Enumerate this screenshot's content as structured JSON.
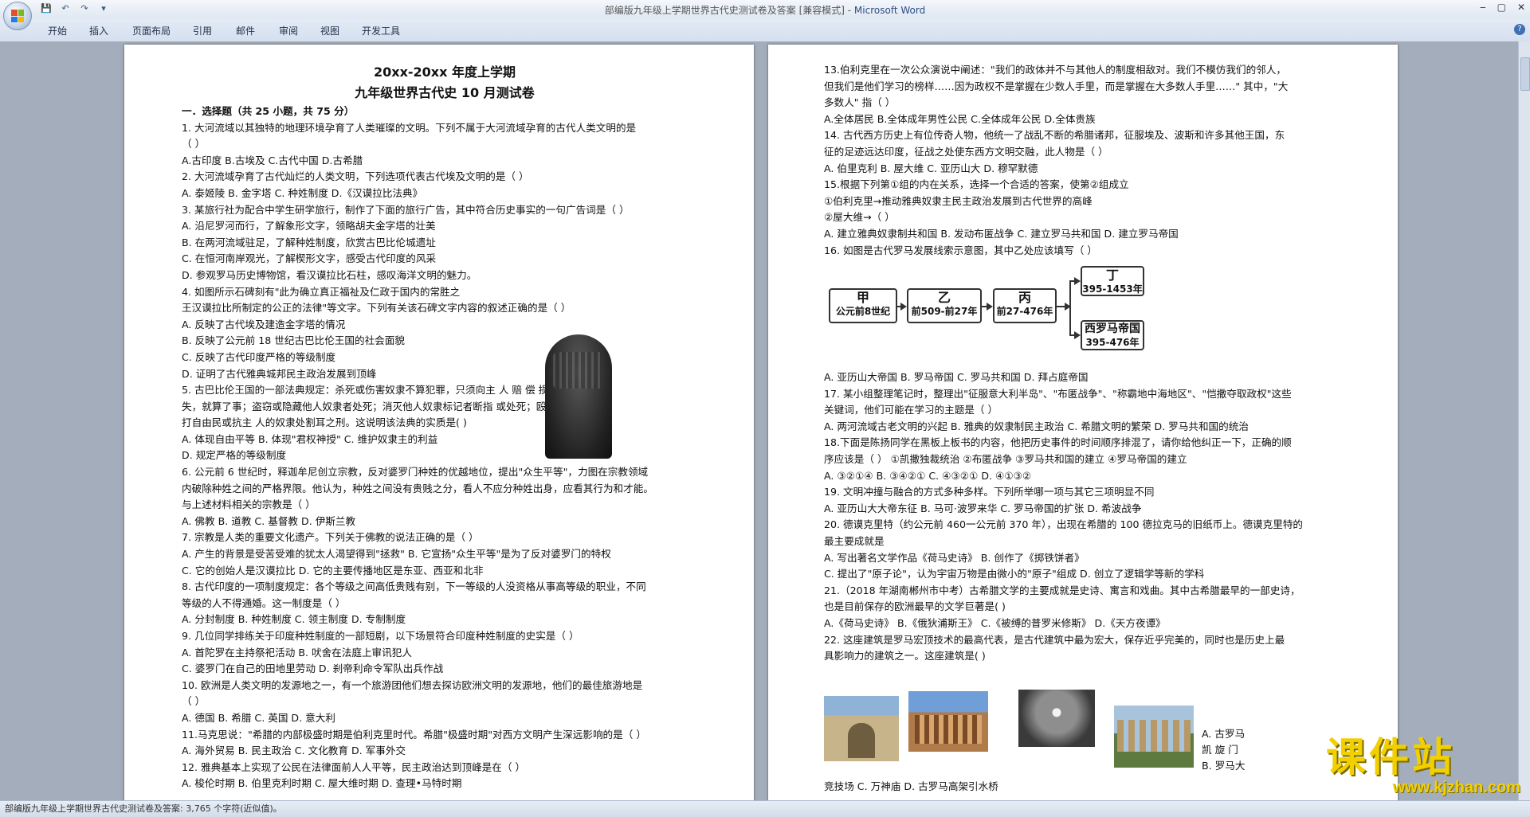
{
  "window": {
    "title": "部编版九年级上学期世界古代史测试卷及答案 [兼容模式] - ",
    "app_name": "Microsoft Word",
    "controls": [
      "‒",
      "▢",
      "✕"
    ]
  },
  "quick_access": {
    "save": "💾",
    "undo": "↶",
    "redo": "↷",
    "customize": "▾"
  },
  "ribbon": {
    "tabs": [
      "开始",
      "插入",
      "页面布局",
      "引用",
      "邮件",
      "审阅",
      "视图",
      "开发工具"
    ],
    "help": "?"
  },
  "page1": {
    "title1": "20xx-20xx 年度上学期",
    "title2": "九年级世界古代史 10 月测试卷",
    "lines": [
      "一．选择题（共 25 小题，共 75 分）",
      "1. 大河流域以其独特的地理环境孕育了人类璀璨的文明。下列不属于大河流域孕育的古代人类文明的是",
      "（     ）",
      "A.古印度      B.古埃及      C.古代中国      D.古希腊",
      "2. 大河流域孕育了古代灿烂的人类文明，下列选项代表古代埃及文明的是（     ）",
      "A. 泰姬陵      B. 金字塔      C. 种姓制度      D.《汉谟拉比法典》",
      "3. 某旅行社为配合中学生研学旅行，制作了下面的旅行广告，其中符合历史事实的一句广告词是（     ）",
      "A. 沿尼罗河而行，了解象形文字，领略胡夫金字塔的壮美",
      "B. 在两河流域驻足，了解种姓制度，欣赏古巴比伦城遗址",
      "C. 在恒河南岸观光，了解楔形文字，感受古代印度的风采",
      "D. 参观罗马历史博物馆，看汉谟拉比石柱，感叹海洋文明的魅力。",
      "4. 如图所示石碑刻有\"此为确立真正福祉及仁政于国内的常胜之",
      "王汉谟拉比所制定的公正的法律\"等文字。下列有关该石碑文字内容的叙述正确的是（     ）",
      "A. 反映了古代埃及建造金字塔的情况",
      "B. 反映了公元前 18 世纪古巴比伦王国的社会面貌",
      "C. 反映了古代印度严格的等级制度",
      "D. 证明了古代雅典城邦民主政治发展到顶峰",
      "5. 古巴比伦王国的一部法典规定：杀死或伤害奴隶不算犯罪，只须向主                           人 赔 偿 损",
      "失，就算了事；盗窃或隐藏他人奴隶者处死；消灭他人奴隶标记者断指                           或处死；殴",
      "打自由民或抗主 人的奴隶处割耳之刑。这说明该法典的实质是(     )",
      "A. 体现自由平等         B. 体现\"君权神授\"         C. 维护奴隶主的利益",
      "D. 规定严格的等级制度",
      "6. 公元前 6 世纪时，释迦牟尼创立宗教，反对婆罗门种姓的优越地位，提出\"众生平等\"，力图在宗教领域",
      "内破除种姓之间的严格界限。他认为，种姓之间没有贵贱之分，看人不应分种姓出身，应看其行为和才能。",
      "与上述材料相关的宗教是（     ）",
      "A. 佛教          B. 道教          C. 基督教          D. 伊斯兰教",
      "7. 宗教是人类的重要文化遗产。下列关于佛教的说法正确的是（     ）",
      "A.  产生的背景是受苦受难的犹太人渴望得到\"拯救\"      B.  它宣扬\"众生平等\"是为了反对婆罗门的特权",
      "C.  它的创始人是汉谟拉比                  D.  它的主要传播地区是东亚、西亚和北非",
      "8. 古代印度的一项制度规定：各个等级之间高低贵贱有别，下一等级的人没资格从事高等级的职业，不同",
      "等级的人不得通婚。这一制度是（     ）",
      "A. 分封制度      B. 种姓制度      C. 领主制度      D. 专制制度",
      "9. 几位同学排练关于印度种姓制度的一部短剧，以下场景符合印度种姓制度的史实是（     ）",
      "A.  首陀罗在主持祭祀活动               B.  吠舍在法庭上审讯犯人",
      "C.  婆罗门在自己的田地里劳动           D.  刹帝利命令军队出兵作战",
      "10. 欧洲是人类文明的发源地之一，有一个旅游团他们想去探访欧洲文明的发源地，他们的最佳旅游地是",
      "（     ）",
      "A. 德国          B. 希腊          C. 英国          D. 意大利",
      "11.马克思说：\"希腊的内部极盛时期是伯利克里时代。希腊\"极盛时期\"对西方文明产生深远影响的是（     ）",
      "A. 海外贸易      B. 民主政治      C. 文化教育      D. 军事外交",
      "12. 雅典基本上实现了公民在法律面前人人平等，民主政治达到顶峰是在（     ）",
      "A. 梭伦时期          B. 伯里克利时期          C. 屋大维时期          D. 查理•马特时期"
    ]
  },
  "page2": {
    "lines_top": [
      "13.伯利克里在一次公众演说中阐述：\"我们的政体并不与其他人的制度相敌对。我们不模仿我们的邻人，",
      "但我们是他们学习的榜样……因为政权不是掌握在少数人手里，而是掌握在大多数人手里……\" 其中，\"大",
      "多数人\" 指（     ）",
      "A.全体居民          B.全体成年男性公民          C.全体成年公民          D.全体贵族",
      "14. 古代西方历史上有位传奇人物，他统一了战乱不断的希腊诸邦，征服埃及、波斯和许多其他王国，东",
      "征的足迹远达印度，征战之处使东西方文明交融，此人物是（     ）",
      "A. 伯里克利      B. 屋大维      C. 亚历山大      D. 穆罕默德",
      "15.根据下列第①组的内在关系，选择一个合适的答案，使第②组成立",
      "①伯利克里→推动雅典奴隶主民主政治发展到古代世界的高峰",
      "②屋大维→（     ）",
      "A. 建立雅典奴隶制共和国      B. 发动布匿战争      C. 建立罗马共和国      D. 建立罗马帝国",
      "16. 如图是古代罗马发展线索示意图，其中乙处应该填写（     ）"
    ],
    "diagram": {
      "jia": {
        "name": "甲",
        "period": "公元前8世纪"
      },
      "yi": {
        "name": "乙",
        "period": "前509-前27年"
      },
      "bing": {
        "name": "丙",
        "period": "前27-476年"
      },
      "ding": {
        "name": "丁",
        "period": "395-1453年"
      },
      "west": {
        "name": "西罗马帝国",
        "period": "395-476年"
      }
    },
    "lines_bottom": [
      "A. 亚历山大帝国      B. 罗马帝国      C. 罗马共和国      D. 拜占庭帝国",
      "17. 某小组整理笔记时，整理出\"征服意大利半岛\"、\"布匿战争\"、\"称霸地中海地区\"、\"恺撒夺取政权\"这些",
      "关键词，他们可能在学习的主题是（     ）",
      "A. 两河流域古老文明的兴起   B. 雅典的奴隶制民主政治   C. 希腊文明的繁荣   D. 罗马共和国的统治",
      "18.下面是陈扬同学在黑板上板书的内容，他把历史事件的时间顺序排混了，请你给他纠正一下，正确的顺",
      "序应该是（     ）  ①凯撒独裁统治  ②布匿战争  ③罗马共和国的建立  ④罗马帝国的建立",
      "A. ③②①④          B. ③④②①          C. ④③②①          D. ④①③②",
      "19. 文明冲撞与融合的方式多种多样。下列所举哪一项与其它三项明显不同",
      "A. 亚历山大大帝东征         B. 马可·波罗来华         C. 罗马帝国的扩张         D. 希波战争",
      "20. 德谟克里特（约公元前 460一公元前 370 年），出现在希腊的 100 德拉克马的旧纸币上。德谟克里特的",
      "最主要成就是",
      "A. 写出著名文学作品《荷马史诗》                               B. 创作了《掷铁饼者》",
      "C. 提出了\"原子论\"，认为宇宙万物是由微小的\"原子\"组成     D. 创立了逻辑学等新的学科",
      "21.（2018 年湖南郴州市中考）古希腊文学的主要成就是史诗、寓言和戏曲。其中古希腊最早的一部史诗，",
      "也是目前保存的欧洲最早的文学巨著是(     )",
      "A.《荷马史诗》      B.《俄狄浦斯王》    C.《被缚的普罗米修斯》      D.《天方夜谭》",
      "22. 这座建筑是罗马宏顶技术的最高代表，是古代建筑中最为宏大，保存近乎完美的，同时也是历史上最",
      "具影响力的建筑之一。这座建筑是(     )"
    ],
    "answer_side": [
      "A. 古罗马",
      "凯 旋 门",
      "B. 罗马大"
    ],
    "answer_last": "竞技场   C. 万神庙         D. 古罗马高架引水桥"
  },
  "statusbar": {
    "text": "部编版九年级上学期世界古代史测试卷及答案: 3,765 个字符(近似值)。"
  },
  "watermark": {
    "title": "课件站",
    "url": "www.kjzhan.com"
  },
  "colors": {
    "title_accent": "#2c4f86",
    "watermark": "#f2d000",
    "workspace": "#a3adbb"
  }
}
